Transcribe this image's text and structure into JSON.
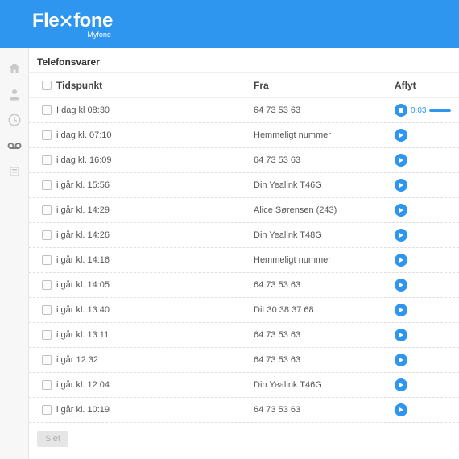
{
  "logo": {
    "main": "Flexfone",
    "sub": "Myfone"
  },
  "page": {
    "title": "Telefonsvarer"
  },
  "columns": {
    "time": "Tidspunkt",
    "from": "Fra",
    "play": "Aflyt"
  },
  "rows": [
    {
      "time": "I dag kl 08:30",
      "from": "64 73 53 63",
      "state": "playing",
      "dur": "0:03"
    },
    {
      "time": "i dag kl. 07:10",
      "from": "Hemmeligt nummer",
      "state": "idle"
    },
    {
      "time": "i dag kl. 16:09",
      "from": "64 73 53 63",
      "state": "idle"
    },
    {
      "time": "i går kl. 15:56",
      "from": "Din Yealink T46G",
      "state": "idle"
    },
    {
      "time": "i går kl. 14:29",
      "from": "Alice Sørensen (243)",
      "state": "idle"
    },
    {
      "time": "i går kl. 14:26",
      "from": "Din Yealink T48G",
      "state": "idle"
    },
    {
      "time": "i går kl. 14:16",
      "from": "Hemmeligt nummer",
      "state": "idle"
    },
    {
      "time": "i går kl. 14:05",
      "from": "64 73 53 63",
      "state": "idle"
    },
    {
      "time": "i går kl. 13:40",
      "from": "Dit 30 38 37 68",
      "state": "idle"
    },
    {
      "time": "i går kl. 13:11",
      "from": "64 73 53 63",
      "state": "idle"
    },
    {
      "time": "i går 12:32",
      "from": "64 73 53 63",
      "state": "idle"
    },
    {
      "time": "i går kl. 12:04",
      "from": "Din Yealink T46G",
      "state": "idle"
    },
    {
      "time": "i går kl. 10:19",
      "from": "64 73 53 63",
      "state": "idle"
    }
  ],
  "footer": {
    "delete": "Slet"
  }
}
